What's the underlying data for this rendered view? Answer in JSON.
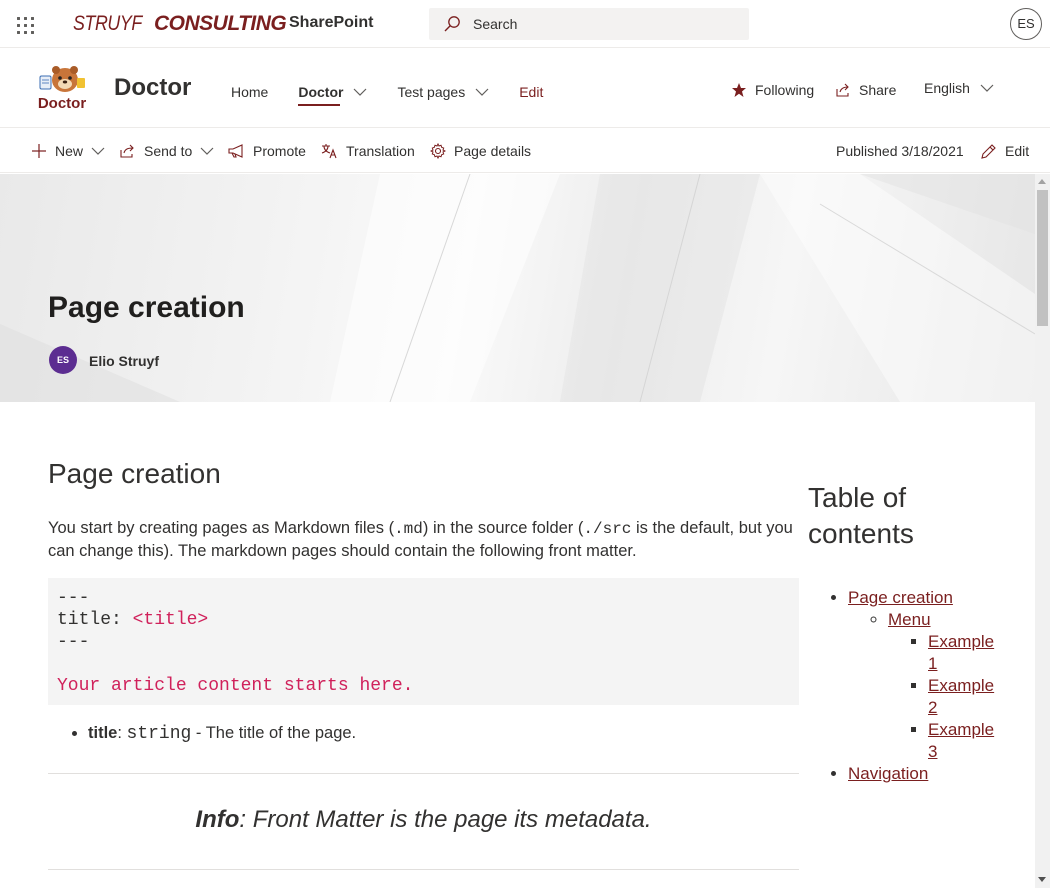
{
  "suite": {
    "org_logo_light": "STRUYF",
    "org_logo_bold": "CONSULTING",
    "app_name": "SharePoint",
    "search_placeholder": "Search",
    "user_initials": "ES"
  },
  "site": {
    "title": "Doctor",
    "logo_text": "Doctor",
    "nav": [
      {
        "label": "Home"
      },
      {
        "label": "Doctor"
      },
      {
        "label": "Test pages"
      },
      {
        "label": "Edit"
      }
    ],
    "following_label": "Following",
    "share_label": "Share",
    "language": "English"
  },
  "commandbar": {
    "new_label": "New",
    "sendto_label": "Send to",
    "promote_label": "Promote",
    "translation_label": "Translation",
    "page_details_label": "Page details",
    "published": "Published 3/18/2021",
    "edit_label": "Edit"
  },
  "hero": {
    "title": "Page creation",
    "author_initials": "ES",
    "author_name": "Elio Struyf"
  },
  "article": {
    "heading": "Page creation",
    "intro_1": "You start by creating pages as Markdown files (",
    "intro_code_1": ".md",
    "intro_2": ") in the source folder (",
    "intro_code_2": "./src",
    "intro_3": " is the default, but you can change this). The markdown pages should contain the following front matter.",
    "code_line_1": "---",
    "code_line_2_key": "title: ",
    "code_line_2_val": "<title>",
    "code_line_3": "---",
    "code_line_5": "Your article content starts here.",
    "bullet_key": "title",
    "bullet_sep": ": ",
    "bullet_type": "string",
    "bullet_desc": " - The title of the page.",
    "info_bold": "Info",
    "info_text": ": Front Matter is the page its metadata."
  },
  "toc": {
    "title": "Table of contents",
    "items": [
      {
        "label": "Page creation"
      },
      {
        "label": "Menu"
      },
      {
        "label": "Example 1"
      },
      {
        "label": "Example 2"
      },
      {
        "label": "Example 3"
      },
      {
        "label": "Navigation"
      }
    ]
  },
  "colors": {
    "accent": "#7a1f1f",
    "avatar": "#5c2d91",
    "code_string": "#d0215b"
  }
}
